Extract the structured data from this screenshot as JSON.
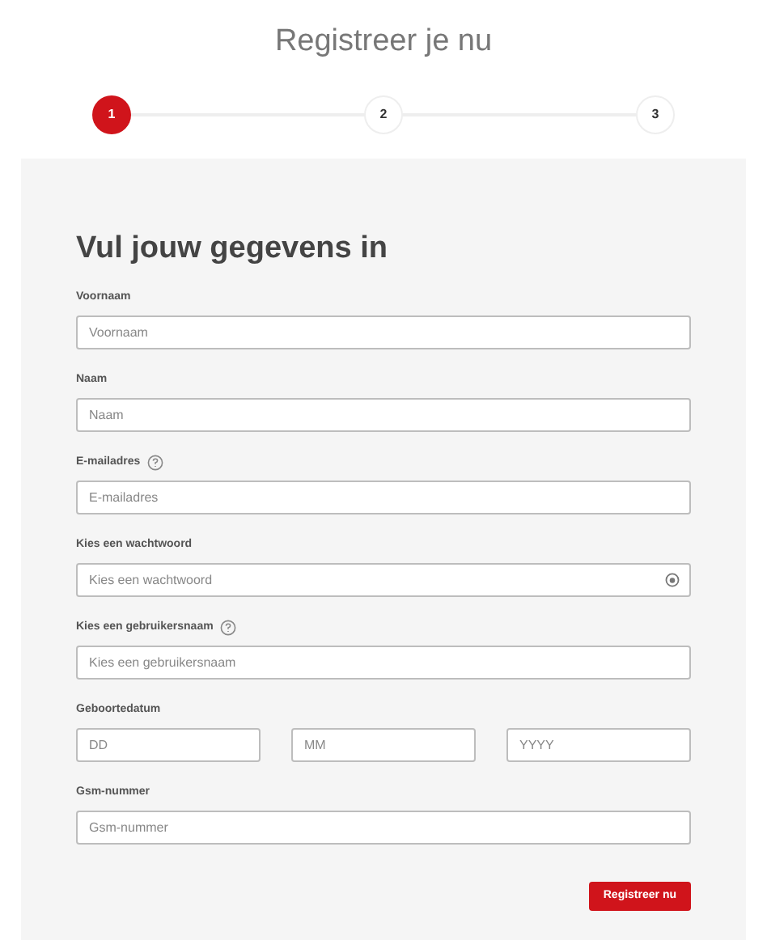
{
  "title": "Registreer je nu",
  "steps": [
    {
      "label": "1",
      "selected": true
    },
    {
      "label": "2",
      "selected": false
    },
    {
      "label": "3",
      "selected": false
    }
  ],
  "form": {
    "heading": "Vul jouw gegevens in",
    "fields": [
      {
        "kind": "text",
        "label": "Voornaam",
        "help": false,
        "placeholder": "Voornaam"
      },
      {
        "kind": "text",
        "label": "Naam",
        "help": false,
        "placeholder": "Naam"
      },
      {
        "kind": "text",
        "label": "E-mailadres",
        "help": true,
        "placeholder": "E-mailadres"
      },
      {
        "kind": "password",
        "label": "Kies een wachtwoord",
        "help": false,
        "placeholder": "Kies een wachtwoord"
      },
      {
        "kind": "text",
        "label": "Kies een gebruikersnaam",
        "help": true,
        "placeholder": "Kies een gebruikersnaam"
      },
      {
        "kind": "date",
        "label": "Geboortedatum",
        "help": false,
        "parts": [
          {
            "placeholder": "DD"
          },
          {
            "placeholder": "MM"
          },
          {
            "placeholder": "YYYY"
          }
        ]
      },
      {
        "kind": "text",
        "label": "Gsm-nummer",
        "help": false,
        "placeholder": "Gsm-nummer"
      }
    ],
    "submit": "Registreer nu"
  }
}
